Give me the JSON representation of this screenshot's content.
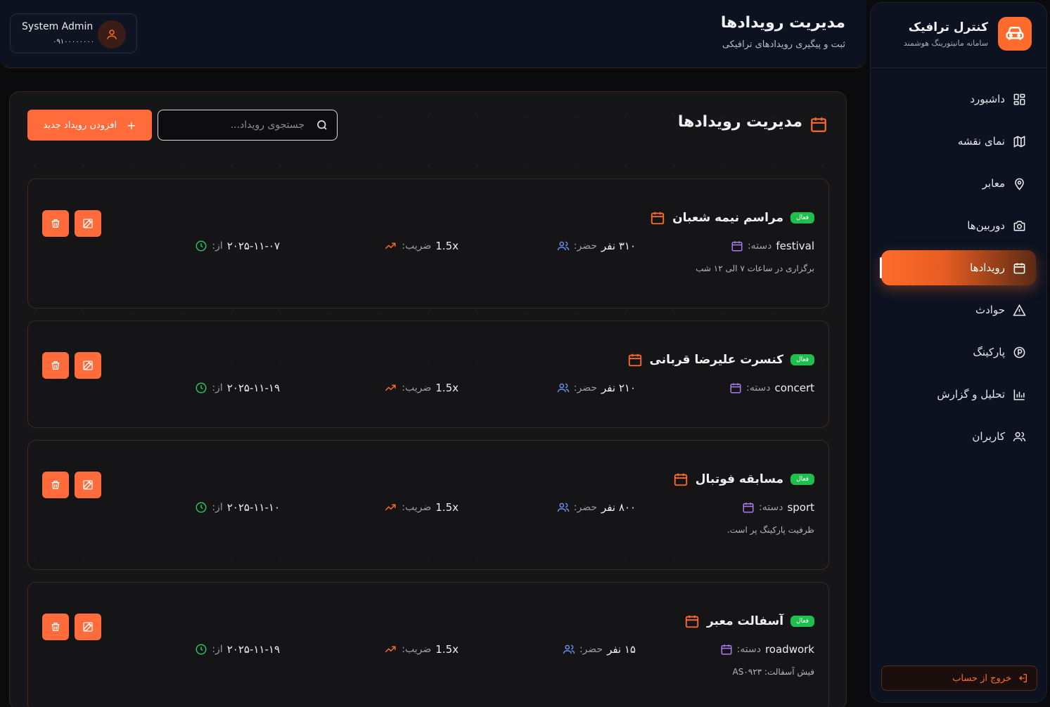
{
  "sidebar": {
    "brand_title": "کنترل ترافیک",
    "brand_subtitle": "سامانه مانیتورینگ هوشمند",
    "items": [
      {
        "label": "داشبورد",
        "icon": "dashboard-icon"
      },
      {
        "label": "نمای نقشه",
        "icon": "map-icon"
      },
      {
        "label": "معابر",
        "icon": "location-pin-icon"
      },
      {
        "label": "دوربین‌ها",
        "icon": "camera-icon"
      },
      {
        "label": "رویدادها",
        "icon": "calendar-icon",
        "active": true
      },
      {
        "label": "حوادث",
        "icon": "warning-icon"
      },
      {
        "label": "پارکینگ",
        "icon": "parking-icon"
      },
      {
        "label": "تحلیل و گزارش",
        "icon": "bar-chart-icon"
      },
      {
        "label": "کاربران",
        "icon": "users-icon"
      }
    ],
    "logout_label": "خروج از حساب"
  },
  "header": {
    "title": "مدیریت رویدادها",
    "subtitle": "ثبت و پیگیری رویدادهای ترافیکی",
    "user_name": "System Admin",
    "user_phone": "۰۹۱۰۰۰۰۰۰۰۰"
  },
  "panel": {
    "title": "مدیریت رویدادها",
    "search_placeholder": "جستجوی رویداد...",
    "add_button": "افزودن رویداد جدید"
  },
  "labels": {
    "category": "دسته:",
    "attendance": "حضر:",
    "multiplier": "ضریب:",
    "from": "از:"
  },
  "colors": {
    "accent": "#ff6b2c",
    "active_badge": "#1fbf4e",
    "calendar_purple": "#a97bf0",
    "users_blue": "#6b8ff0",
    "clock_green": "#22c55e"
  },
  "events": [
    {
      "title": "مراسم نیمه شعبان",
      "status": "فعال",
      "category": "festival",
      "attendance": "۳۱۰ نفر",
      "multiplier": "1.5x",
      "from": "۲۰۲۵-۱۱-۰۷",
      "description": "برگزاری در ساعات ۷ الی ۱۲ شب"
    },
    {
      "title": "کنسرت علیرضا قربانی",
      "status": "فعال",
      "category": "concert",
      "attendance": "۲۱۰ نفر",
      "multiplier": "1.5x",
      "from": "۲۰۲۵-۱۱-۱۹",
      "description": ""
    },
    {
      "title": "مسابقه فوتبال",
      "status": "فعال",
      "category": "sport",
      "attendance": "۸۰۰ نفر",
      "multiplier": "1.5x",
      "from": "۲۰۲۵-۱۱-۱۰",
      "description": "ظرفیت پارکینگ پر است."
    },
    {
      "title": "آسفالت معبر",
      "status": "فعال",
      "category": "roadwork",
      "attendance": "۱۵ نفر",
      "multiplier": "1.5x",
      "from": "۲۰۲۵-۱۱-۱۹",
      "description": "فیش آسفالت: AS۰۹۲۳"
    }
  ]
}
